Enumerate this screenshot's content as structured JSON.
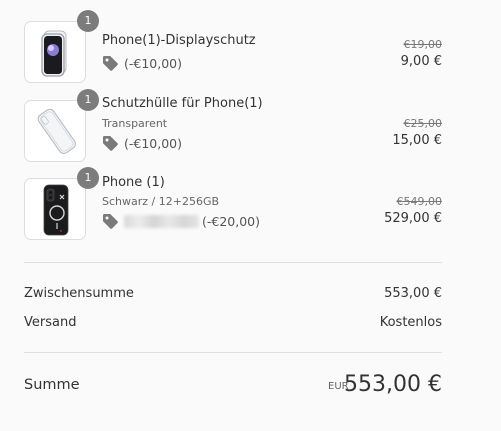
{
  "items": [
    {
      "quantity": "1",
      "name": "Phone(1)-Displayschutz",
      "variant": "",
      "discount": "(-€10,00)",
      "original_price": "€19,00",
      "price": "9,00 €",
      "image_icon": "screen-protector-image"
    },
    {
      "quantity": "1",
      "name": "Schutzhülle für Phone(1)",
      "variant": "Transparent",
      "discount": "(-€10,00)",
      "original_price": "€25,00",
      "price": "15,00 €",
      "image_icon": "clear-case-image"
    },
    {
      "quantity": "1",
      "name": "Phone (1)",
      "variant": "Schwarz / 12+256GB",
      "discount": "(-€20,00)",
      "discount_code_hidden": true,
      "original_price": "€549,00",
      "price": "529,00 €",
      "image_icon": "phone-image"
    }
  ],
  "summary": {
    "subtotal_label": "Zwischensumme",
    "subtotal_value": "553,00 €",
    "shipping_label": "Versand",
    "shipping_value": "Kostenlos"
  },
  "total": {
    "label": "Summe",
    "currency": "EUR",
    "value": "553,00 €"
  },
  "icons": {
    "discount": "discount-tag-icon"
  },
  "colors": {
    "quantity_badge": "#7c7c7c",
    "discount_tag": "#7a7a7a",
    "text": "#333333",
    "background": "#fafafa"
  }
}
